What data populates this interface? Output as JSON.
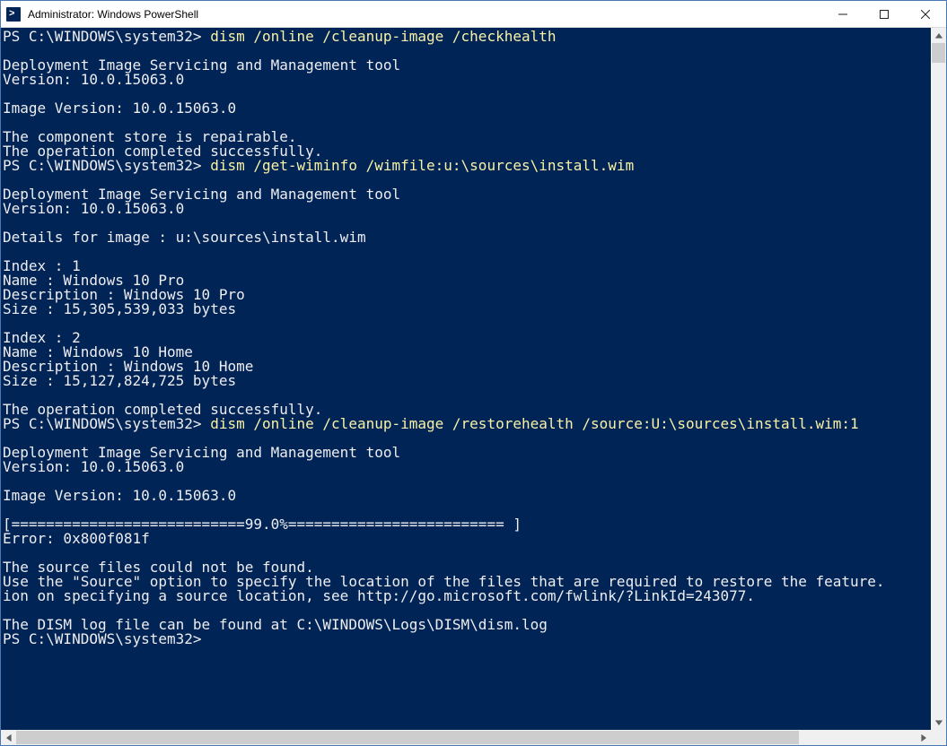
{
  "window": {
    "title": "Administrator: Windows PowerShell"
  },
  "prompt": "PS C:\\WINDOWS\\system32> ",
  "commands": {
    "c1": "dism /online /cleanup-image /checkhealth",
    "c2": "dism /get-wiminfo /wimfile:u:\\sources\\install.wim",
    "c3": "dism /online /cleanup-image /restorehealth /source:U:\\sources\\install.wim:1"
  },
  "output": {
    "tool_header": "Deployment Image Servicing and Management tool",
    "tool_version": "Version: 10.0.15063.0",
    "image_version": "Image Version: 10.0.15063.0",
    "repairable": "The component store is repairable.",
    "completed": "The operation completed successfully.",
    "details_for": "Details for image : u:\\sources\\install.wim",
    "idx1_index": "Index : 1",
    "idx1_name": "Name : Windows 10 Pro",
    "idx1_desc": "Description : Windows 10 Pro",
    "idx1_size": "Size : 15,305,539,033 bytes",
    "idx2_index": "Index : 2",
    "idx2_name": "Name : Windows 10 Home",
    "idx2_desc": "Description : Windows 10 Home",
    "idx2_size": "Size : 15,127,824,725 bytes",
    "progress": "[===========================99.0%========================= ]",
    "error": "Error: 0x800f081f",
    "src_not_found": "The source files could not be found.",
    "src_hint1": "Use the \"Source\" option to specify the location of the files that are required to restore the feature. ",
    "src_hint2": "ion on specifying a source location, see http://go.microsoft.com/fwlink/?LinkId=243077.",
    "log_file": "The DISM log file can be found at C:\\WINDOWS\\Logs\\DISM\\dism.log"
  },
  "scroll": {
    "v_thumb_top": 0,
    "v_thumb_height": 22,
    "h_thumb_left": 0,
    "h_thumb_width": 872
  }
}
